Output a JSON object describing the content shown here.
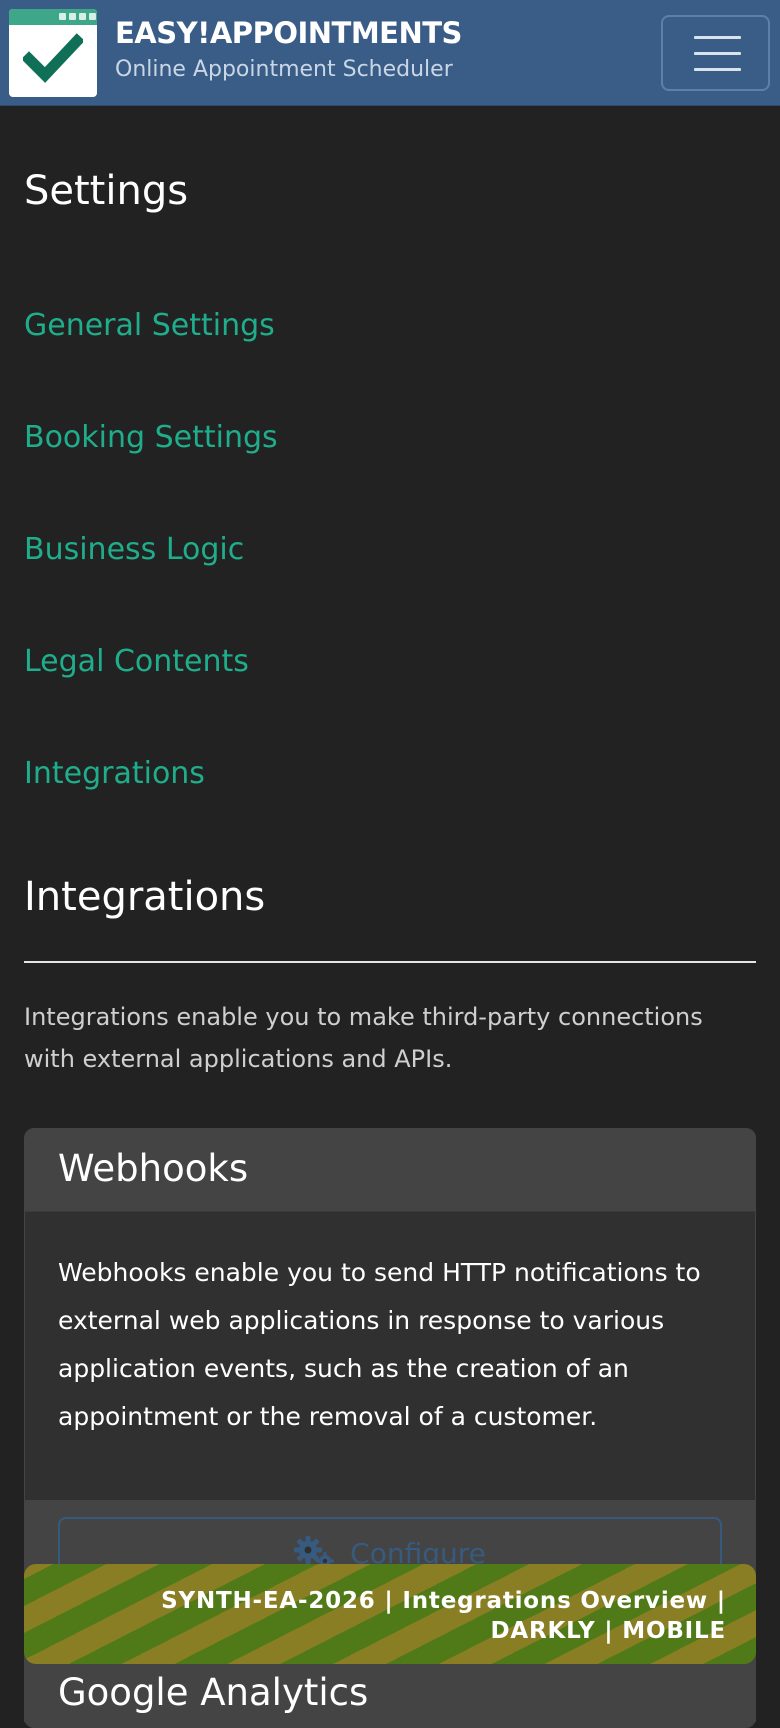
{
  "navbar": {
    "brand_title": "EASY!APPOINTMENTS",
    "brand_subtitle": "Online Appointment Scheduler",
    "logo_icon": "calendar-check-icon",
    "menu_icon": "hamburger-menu-icon",
    "background_color": "#3a5d87"
  },
  "page": {
    "title": "Settings"
  },
  "settings_nav": {
    "items": [
      {
        "label": "General Settings"
      },
      {
        "label": "Booking Settings"
      },
      {
        "label": "Business Logic"
      },
      {
        "label": "Legal Contents"
      },
      {
        "label": "Integrations"
      }
    ],
    "link_color": "#1fae8c"
  },
  "integrations": {
    "heading": "Integrations",
    "description": "Integrations enable you to make third-party connections with external applications and APIs.",
    "cards": [
      {
        "title": "Webhooks",
        "body": "Webhooks enable you to send HTTP notifications to external web applications in response to various application events, such as the creation of an appointment or the removal of a customer.",
        "button_label": "Configure",
        "button_icon": "gears-icon"
      },
      {
        "title": "Google Analytics"
      }
    ]
  },
  "watermark": {
    "text": "SYNTH-EA-2026 | Integrations Overview | DARKLY | MOBILE"
  }
}
